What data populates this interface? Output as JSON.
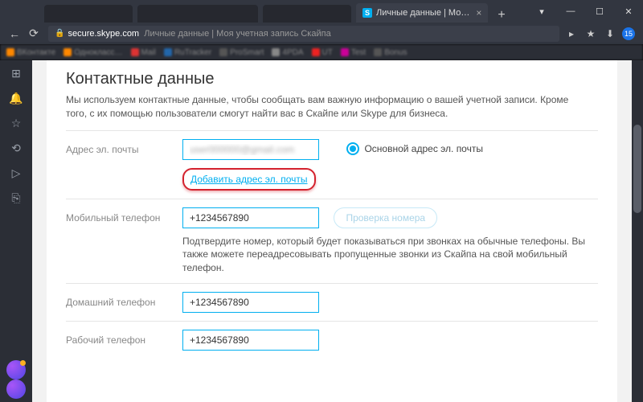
{
  "browser": {
    "tab_title": "Личные данные | Мо…",
    "domain": "secure.skype.com",
    "path_text": "Личные данные | Моя учетная запись Скайпа",
    "dl_count": "15"
  },
  "page": {
    "heading": "Контактные данные",
    "intro": "Мы используем контактные данные, чтобы сообщать вам важную информацию о вашей учетной записи. Кроме того, с их помощью пользователи смогут найти вас в Скайпе или Skype для бизнеса.",
    "email": {
      "label": "Адрес эл. почты",
      "value": "user000000@gmail.com",
      "primary_label": "Основной адрес эл. почты",
      "add_link": "Добавить адрес эл. почты"
    },
    "mobile": {
      "label": "Мобильный телефон",
      "value": "+1234567890",
      "verify_label": "Проверка номера",
      "note": "Подтвердите номер, который будет показываться при звонках на обычные телефоны. Вы также можете переадресовывать пропущенные звонки из Скайпа на свой мобильный телефон."
    },
    "home": {
      "label": "Домашний телефон",
      "value": "+1234567890"
    },
    "work": {
      "label": "Рабочий телефон",
      "value": "+1234567890"
    }
  }
}
